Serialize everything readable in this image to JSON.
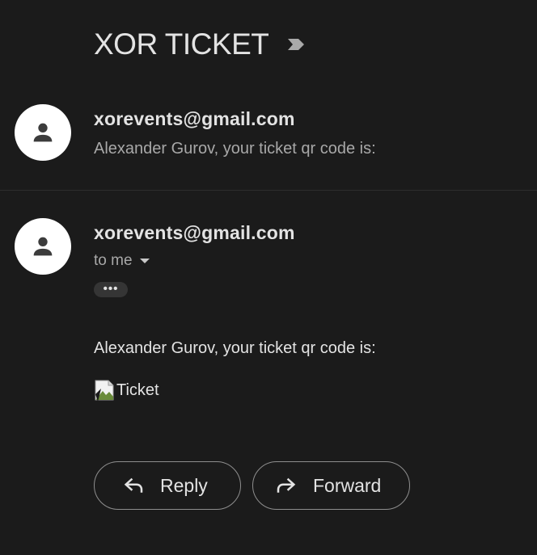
{
  "thread": {
    "subject": "XOR TICKET",
    "importance_icon": "importance-marker-icon"
  },
  "messages": [
    {
      "sender": "xorevents@gmail.com",
      "snippet": "Alexander Gurov, your ticket qr code is:"
    },
    {
      "sender": "xorevents@gmail.com",
      "recipient": "to me",
      "more_label": "•••",
      "body": "Alexander Gurov, your ticket qr code is:",
      "image_alt": "Ticket"
    }
  ],
  "actions": {
    "reply_label": "Reply",
    "forward_label": "Forward"
  },
  "colors": {
    "background": "#1b1b1b",
    "text_primary": "#e3e3e3",
    "text_secondary": "#a8a8a8",
    "button_border": "#8e8e8e"
  }
}
